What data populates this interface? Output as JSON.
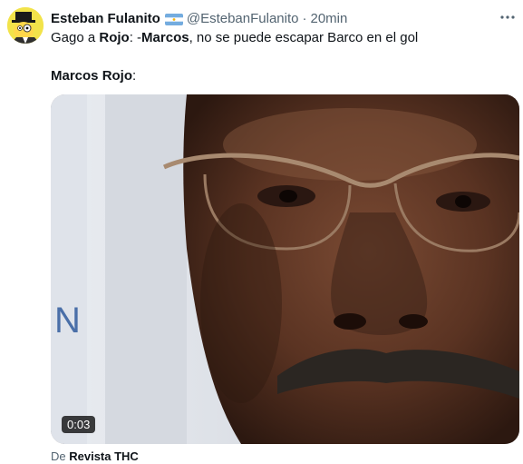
{
  "tweet": {
    "author_name": "Esteban Fulanito",
    "handle": "@EstebanFulanito",
    "separator": "·",
    "time": "20min",
    "text_line1": {
      "prefix": "Gago a ",
      "bold1": "Rojo",
      "mid": ": -",
      "bold2": "Marcos",
      "suffix": ", no se puede escapar Barco en el gol"
    },
    "text_line2": {
      "bold": "Marcos Rojo",
      "suffix": ":"
    }
  },
  "media": {
    "type": "video",
    "duration": "0:03",
    "background_letter": "N"
  },
  "source": {
    "prefix": "De ",
    "name": "Revista THC"
  },
  "icons": {
    "more": "more-horizontal-icon",
    "flag": "argentina-flag-icon",
    "avatar": "cartoon-avatar"
  },
  "colors": {
    "text_primary": "#0f1419",
    "text_secondary": "#536471",
    "avatar_bg": "#f2e34a",
    "flag_blue": "#74acdf"
  }
}
